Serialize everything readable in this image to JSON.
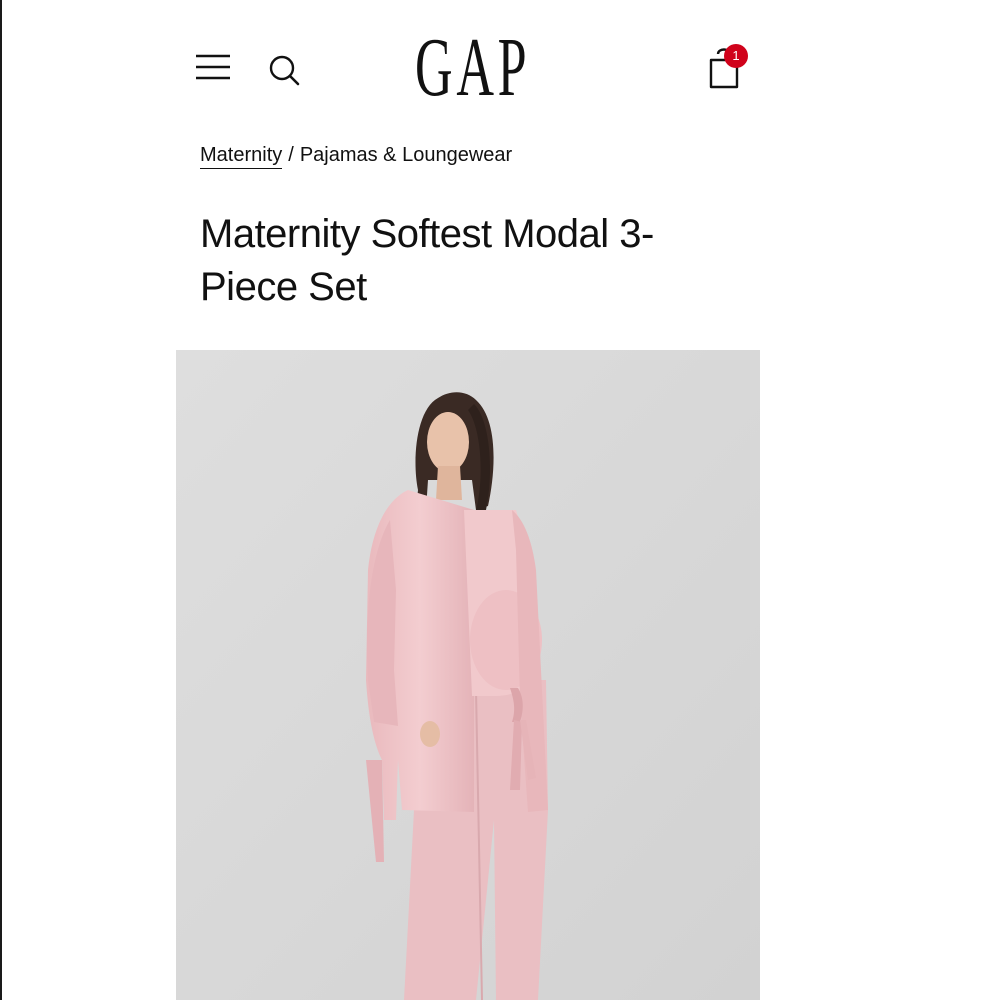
{
  "header": {
    "logo_text": "GAP",
    "bag_count": "1",
    "colors": {
      "badge": "#d0021b",
      "text": "#111111"
    },
    "icons": [
      "hamburger-menu-icon",
      "search-icon",
      "shopping-bag-icon"
    ]
  },
  "breadcrumb": {
    "items": [
      "Maternity",
      "Pajamas & Loungewear"
    ],
    "separator": "/"
  },
  "product": {
    "title": "Maternity Softest Modal 3-Piece Set",
    "image_colors": {
      "background": "#dcdcdc",
      "garment": "#eec3c6",
      "hair": "#3a2a24",
      "skin": "#e8c2aa"
    }
  }
}
